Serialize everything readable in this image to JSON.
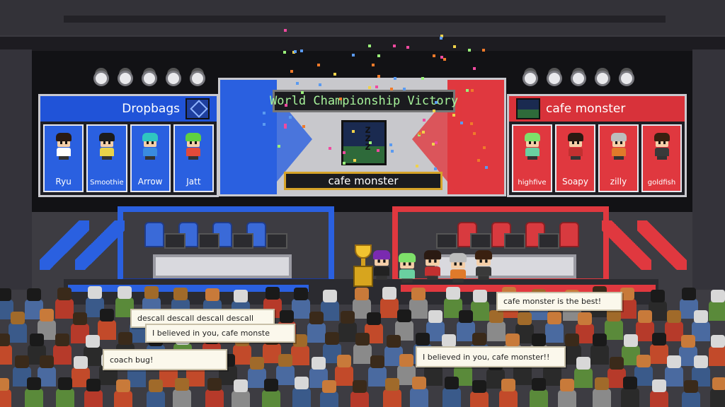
{
  "scoreboard": {
    "title": "World Championship Victory",
    "winner": "cafe monster"
  },
  "teams": {
    "blue": {
      "name": "Dropbags",
      "logo_icon": "dropbags-logo",
      "color": "#2a60e0",
      "players": [
        {
          "name": "Ryu",
          "hair": "#2a1a12",
          "shirt": "#ffffff"
        },
        {
          "name": "Smoothie",
          "hair": "#1c1c1c",
          "shirt": "#e8d24a"
        },
        {
          "name": "Arrow",
          "hair": "#2fc6c0",
          "shirt": "#3a8be0"
        },
        {
          "name": "Jatt",
          "hair": "#5fd040",
          "shirt": "#e24a3a"
        }
      ]
    },
    "red": {
      "name": "cafe monster",
      "logo_icon": "cafe-monster-logo",
      "color": "#e0383f",
      "players": [
        {
          "name": "highfive",
          "hair": "#7ee06a",
          "shirt": "#6ad0a0"
        },
        {
          "name": "Soapy",
          "hair": "#2a1a12",
          "shirt": "#c23030"
        },
        {
          "name": "zilly",
          "hair": "#bdbdbd",
          "shirt": "#e07a2a"
        },
        {
          "name": "goldfish",
          "hair": "#3a2010",
          "shirt": "#3a3a3a"
        }
      ]
    }
  },
  "chat": [
    "descall descall descall descall",
    "I believed in you, cafe monste",
    "coach bug!",
    "cafe monster is the best!",
    "I believed in you, cafe monster!!"
  ],
  "colors": {
    "trophy": "#f2c330",
    "title_text": "#a6f29a"
  }
}
